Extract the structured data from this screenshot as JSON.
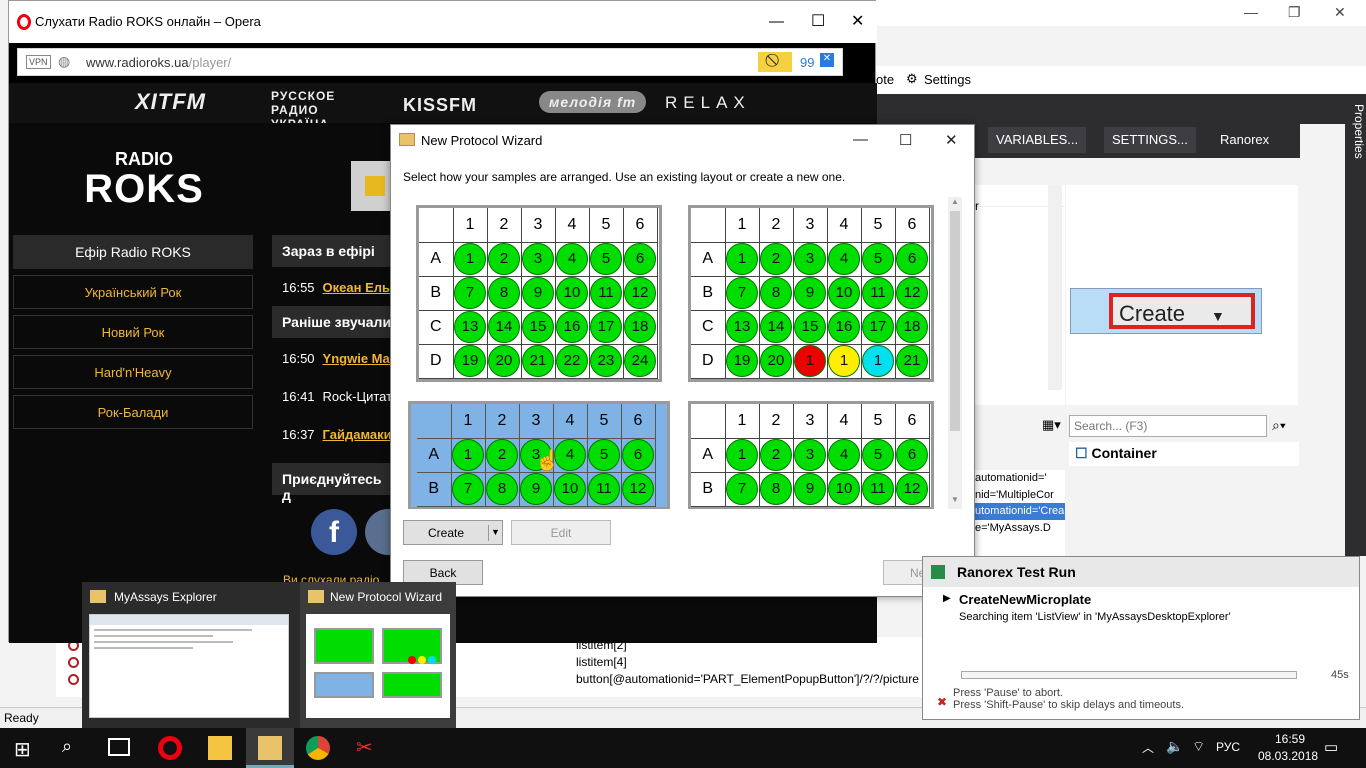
{
  "background_app": {
    "menu_right": [
      "ote",
      "Settings"
    ],
    "dark_toolbar": [
      "VARIABLES...",
      "SETTINGS...",
      "Ranorex"
    ],
    "properties_tab": "Properties",
    "list_partial": "r",
    "search_placeholder": "Search... (F3)",
    "container_label": "Container",
    "screenshot_create": "Create",
    "xpath_lines": [
      "automationid='",
      "nid='MultipleCor",
      "utomationid='Crea",
      "",
      "e='MyAssays.D"
    ],
    "bottom_rows": [
      "listitem[2]",
      "listitem[4]",
      "button[@automationid='PART_ElementPopupButton']/?/?/picture"
    ],
    "status": "Ready"
  },
  "opera": {
    "title": "Слухати Radio ROKS онлайн – Opera",
    "vpn": "VPN",
    "url_host": "www.radioroks.ua",
    "url_path": "/player/",
    "badge_count": "99",
    "brands": [
      "ХІТFM",
      "РУССКОЕ РАДИО УКРАЇНА",
      "KISSFM",
      "мелодія fm",
      "RELAX"
    ],
    "logo_top": "RADIO",
    "logo_main": "ROKS",
    "menu_active": "Ефір Radio ROKS",
    "menu": [
      "Український Рок",
      "Новий Рок",
      "Hard'n'Heavy",
      "Рок-Балади"
    ],
    "now_playing_head": "Зараз в ефірі",
    "now_playing": {
      "time": "16:55",
      "title": "Океан Ель"
    },
    "played_head": "Раніше звучали",
    "played": [
      {
        "time": "16:50",
        "title": "Yngwie Mal"
      },
      {
        "time": "16:41",
        "title": "Rock-Цитат"
      },
      {
        "time": "16:37",
        "title": "Гайдамаки"
      }
    ],
    "join_head": "Приєднуйтесь д",
    "footer_partial": "Ви слухали радіо"
  },
  "wizard": {
    "title": "New Protocol Wizard",
    "instruction": "Select how your samples are arranged. Use an existing layout or create a new one.",
    "columns": [
      "1",
      "2",
      "3",
      "4",
      "5",
      "6"
    ],
    "rows": [
      "A",
      "B",
      "C",
      "D"
    ],
    "plates": [
      {
        "wells": [
          [
            "1",
            "2",
            "3",
            "4",
            "5",
            "6"
          ],
          [
            "7",
            "8",
            "9",
            "10",
            "11",
            "12"
          ],
          [
            "13",
            "14",
            "15",
            "16",
            "17",
            "18"
          ],
          [
            "19",
            "20",
            "21",
            "22",
            "23",
            "24"
          ]
        ],
        "colors": [
          [
            "g",
            "g",
            "g",
            "g",
            "g",
            "g"
          ],
          [
            "g",
            "g",
            "g",
            "g",
            "g",
            "g"
          ],
          [
            "g",
            "g",
            "g",
            "g",
            "g",
            "g"
          ],
          [
            "g",
            "g",
            "g",
            "g",
            "g",
            "g"
          ]
        ]
      },
      {
        "wells": [
          [
            "1",
            "2",
            "3",
            "4",
            "5",
            "6"
          ],
          [
            "7",
            "8",
            "9",
            "10",
            "11",
            "12"
          ],
          [
            "13",
            "14",
            "15",
            "16",
            "17",
            "18"
          ],
          [
            "19",
            "20",
            "1",
            "1",
            "1",
            "21"
          ]
        ],
        "colors": [
          [
            "g",
            "g",
            "g",
            "g",
            "g",
            "g"
          ],
          [
            "g",
            "g",
            "g",
            "g",
            "g",
            "g"
          ],
          [
            "g",
            "g",
            "g",
            "g",
            "g",
            "g"
          ],
          [
            "g",
            "g",
            "red",
            "yellow",
            "cyan",
            "g"
          ]
        ]
      },
      {
        "wells": [
          [
            "1",
            "2",
            "3",
            "4",
            "5",
            "6"
          ],
          [
            "7",
            "8",
            "9",
            "10",
            "11",
            "12"
          ]
        ],
        "colors": [
          [
            "g",
            "g",
            "g",
            "g",
            "g",
            "g"
          ],
          [
            "g",
            "g",
            "g",
            "g",
            "g",
            "g"
          ]
        ]
      },
      {
        "wells": [
          [
            "1",
            "2",
            "3",
            "4",
            "5",
            "6"
          ],
          [
            "7",
            "8",
            "9",
            "10",
            "11",
            "12"
          ]
        ],
        "colors": [
          [
            "g",
            "g",
            "g",
            "g",
            "g",
            "g"
          ],
          [
            "g",
            "g",
            "g",
            "g",
            "g",
            "g"
          ]
        ]
      }
    ],
    "create": "Create",
    "edit": "Edit",
    "back": "Back",
    "next": "Ne"
  },
  "thumbnails": [
    {
      "title": "MyAssays Explorer"
    },
    {
      "title": "New Protocol Wizard"
    }
  ],
  "test_run": {
    "title": "Ranorex Test Run",
    "step": "CreateNewMicroplate",
    "searching": "Searching item 'ListView' in 'MyAssaysDesktopExplorer'",
    "timeout": "45s",
    "hint1": "Press 'Pause' to abort.",
    "hint2": "Press 'Shift-Pause' to skip delays and timeouts."
  },
  "taskbar": {
    "lang": "РУС",
    "time": "16:59",
    "date": "08.03.2018"
  },
  "colors": {
    "well_green": "#00dd00",
    "selected_plate": "#7fb3e6",
    "accent_orange": "#f2b635"
  }
}
